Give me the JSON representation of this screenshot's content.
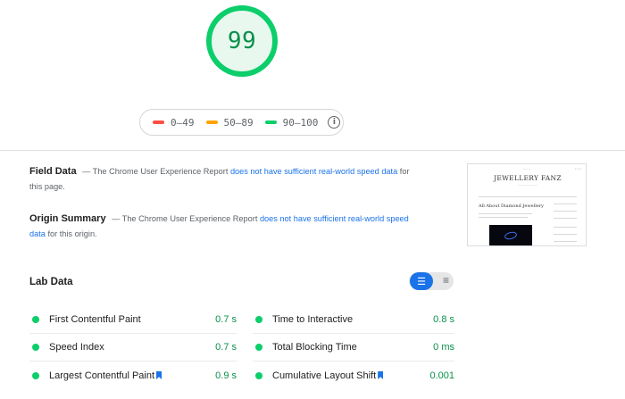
{
  "score": "99",
  "legend": [
    {
      "range": "0–49",
      "color": "#ff4e42"
    },
    {
      "range": "50–89",
      "color": "#ffa400"
    },
    {
      "range": "90–100",
      "color": "#0cce6b"
    }
  ],
  "legend_info_icon": "info-icon",
  "field_data": {
    "title": "Field Data",
    "pre": "— The Chrome User Experience Report",
    "link": "does not have sufficient real-world speed data",
    "post": "for this page."
  },
  "origin_summary": {
    "title": "Origin Summary",
    "pre": "— The Chrome User Experience Report",
    "link": "does not have sufficient real-world speed data",
    "post": "for this origin."
  },
  "thumbnail": {
    "site_name": "JEWELLERY FANZ",
    "heading": "All About Diamond Jewellery"
  },
  "lab_data": {
    "title": "Lab Data",
    "toggle_icons": [
      "compact-view-icon",
      "list-view-icon"
    ],
    "metrics": [
      {
        "left": {
          "label": "First Contentful Paint",
          "value": "0.7 s",
          "bookmark": false
        },
        "right": {
          "label": "Time to Interactive",
          "value": "0.8 s",
          "bookmark": false
        }
      },
      {
        "left": {
          "label": "Speed Index",
          "value": "0.7 s",
          "bookmark": false
        },
        "right": {
          "label": "Total Blocking Time",
          "value": "0 ms",
          "bookmark": false
        }
      },
      {
        "left": {
          "label": "Largest Contentful Paint",
          "value": "0.9 s",
          "bookmark": true
        },
        "right": {
          "label": "Cumulative Layout Shift",
          "value": "0.001",
          "bookmark": true
        }
      }
    ],
    "status_color": "#0cce6b"
  }
}
